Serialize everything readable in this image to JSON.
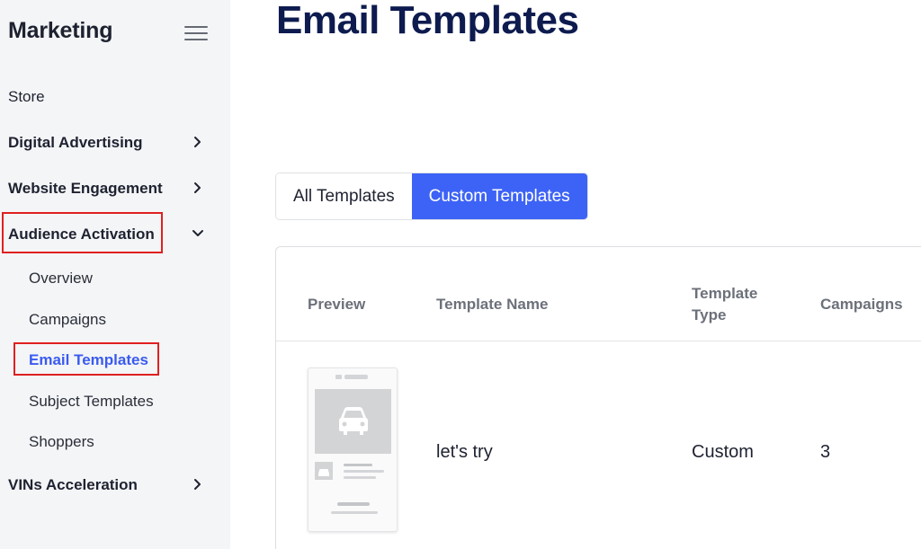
{
  "sidebar": {
    "title": "Marketing",
    "items": [
      {
        "label": "Store"
      },
      {
        "label": "Digital Advertising"
      },
      {
        "label": "Website Engagement"
      },
      {
        "label": "Audience Activation"
      },
      {
        "label": "VINs Acceleration"
      }
    ],
    "sub_items": [
      {
        "label": "Overview"
      },
      {
        "label": "Campaigns"
      },
      {
        "label": "Email Templates"
      },
      {
        "label": "Subject Templates"
      },
      {
        "label": "Shoppers"
      }
    ]
  },
  "main": {
    "title": "Email Templates",
    "tabs": [
      {
        "label": "All Templates"
      },
      {
        "label": "Custom Templates"
      }
    ],
    "table": {
      "headers": [
        "Preview",
        "Template Name",
        "Template Type",
        "Campaigns"
      ],
      "rows": [
        {
          "name": "let's try",
          "type": "Custom",
          "campaigns": "3"
        }
      ]
    }
  },
  "colors": {
    "accent": "#3d63f6",
    "highlight": "#e0201f",
    "title": "#0d1b4f"
  }
}
